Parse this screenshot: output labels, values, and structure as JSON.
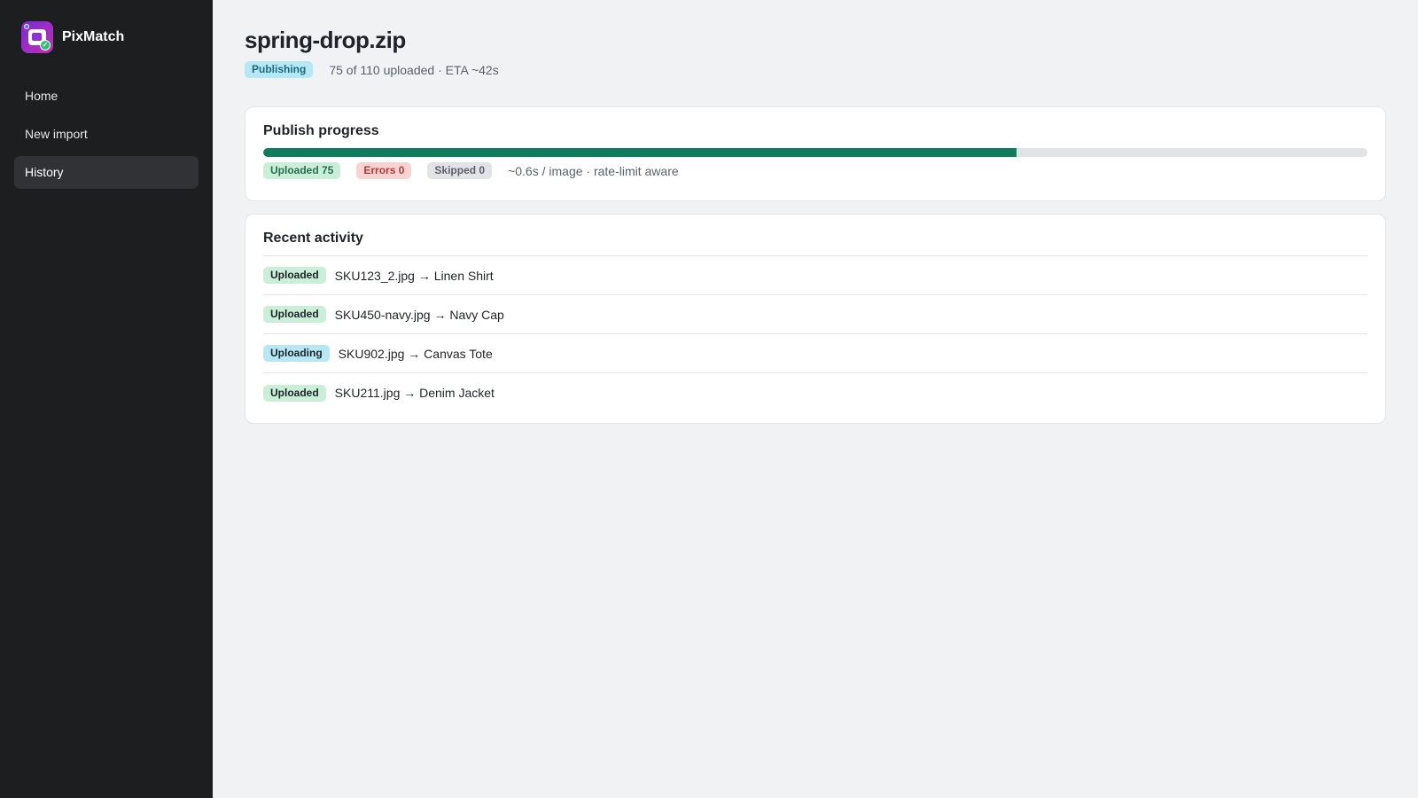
{
  "app": {
    "name": "PixMatch",
    "logo_icon": "photo-check-icon"
  },
  "sidebar": {
    "items": [
      {
        "label": "Home",
        "active": false
      },
      {
        "label": "New import",
        "active": false
      },
      {
        "label": "History",
        "active": true
      }
    ]
  },
  "header": {
    "title": "spring-drop.zip",
    "status_badge": "Publishing",
    "summary": "75 of 110 uploaded · ETA ~42s"
  },
  "progress": {
    "title": "Publish progress",
    "uploaded": 75,
    "total": 110,
    "fraction": 0.682,
    "uploaded_badge": "Uploaded 75",
    "errors_badge": "Errors 0",
    "skipped_badge": "Skipped 0",
    "rate_text": "~0.6s / image · rate-limit aware"
  },
  "activity": {
    "title": "Recent activity",
    "rows": [
      {
        "status": "Uploaded",
        "text": "SKU123_2.jpg → Linen Shirt"
      },
      {
        "status": "Uploaded",
        "text": "SKU450-navy.jpg → Navy Cap"
      },
      {
        "status": "Uploading",
        "text": "SKU902.jpg → Canvas Tote"
      },
      {
        "status": "Uploaded",
        "text": "SKU211.jpg → Denim Jacket"
      }
    ]
  },
  "colors": {
    "sidebar_bg": "#1d1e20",
    "progress_fill": "#0f7c5c",
    "brand_gradient_start": "#7a2bd8",
    "brand_gradient_end": "#c12fb0"
  }
}
